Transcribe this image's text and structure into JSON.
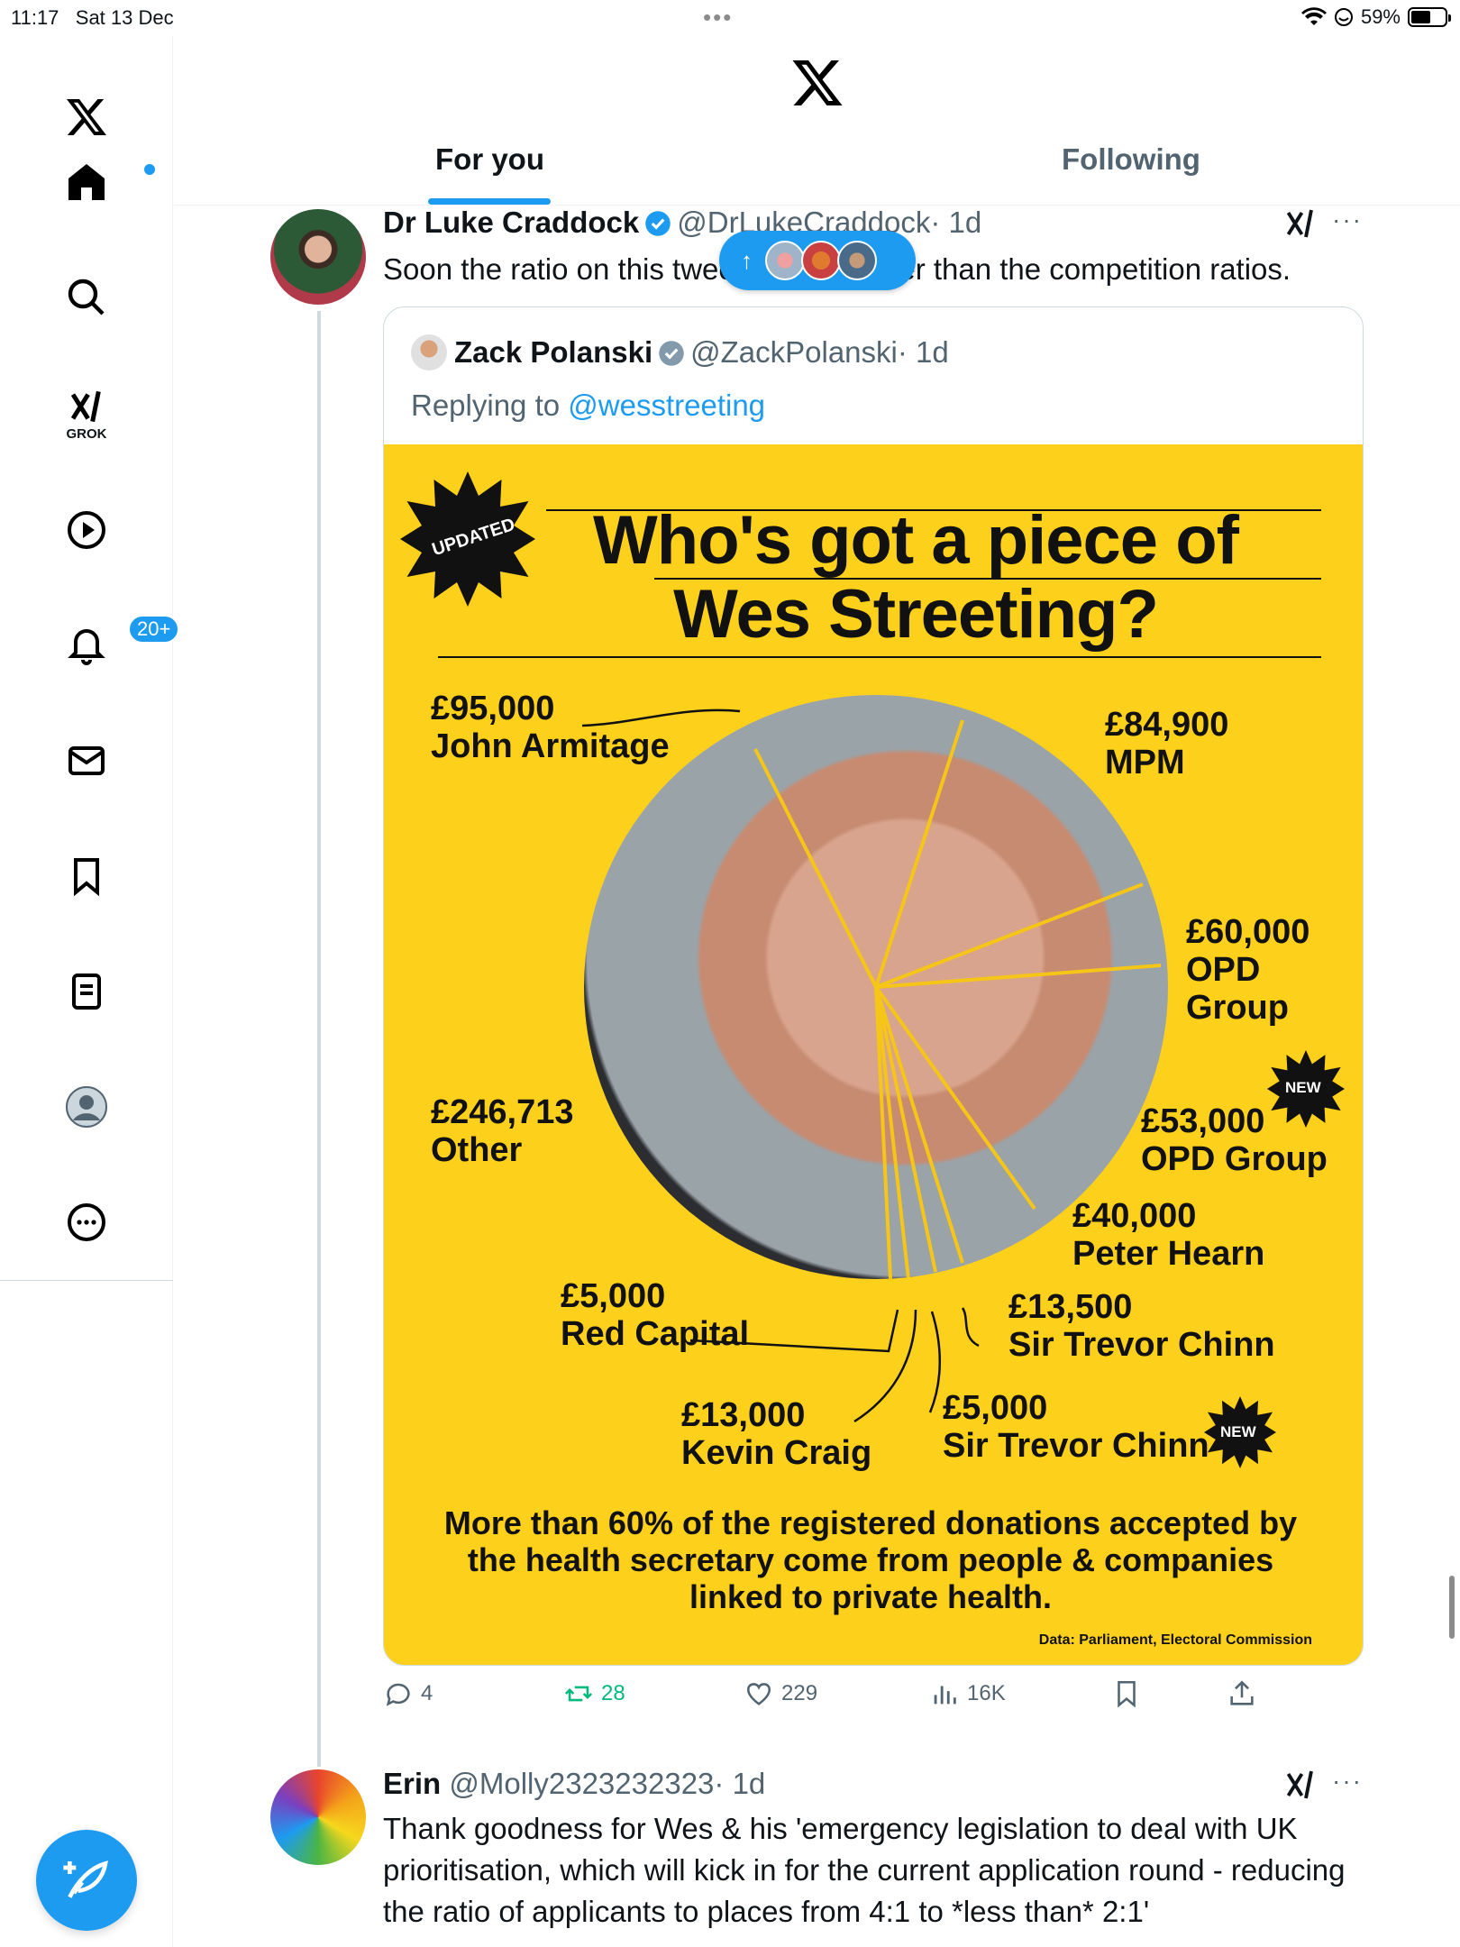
{
  "status": {
    "time": "11:17",
    "date": "Sat 13 Dec",
    "battery": "59%",
    "battery_level": 0.59
  },
  "sidebar": {
    "grok_label": "GROK",
    "notifications_badge": "20+"
  },
  "tabs": {
    "for_you": "For you",
    "following": "Following",
    "active": "for_you"
  },
  "post1": {
    "name": "Dr Luke Craddock",
    "handle": "@DrLukeCraddock",
    "time": "· 1d",
    "text": "Soon the ratio on this tweet will be higher than the competition ratios."
  },
  "quote": {
    "name": "Zack Polanski",
    "handle": "@ZackPolanski",
    "time": "· 1d",
    "replying_prefix": "Replying to",
    "replying_to": "@wesstreeting"
  },
  "infographic": {
    "badge_updated": "UPDATED",
    "title": "Who's got a piece of Wes Streeting?",
    "labels": {
      "armitage": "£95,000\nJohn Armitage",
      "mpm": "£84,900\nMPM",
      "opd1": "£60,000\nOPD\nGroup",
      "opd2": "£53,000\nOPD Group",
      "hearn": "£40,000\nPeter Hearn",
      "chinn1": "£13,500\nSir Trevor Chinn",
      "chinn2": "£5,000\nSir Trevor Chinn",
      "craig": "£13,000\nKevin Craig",
      "red": "£5,000\nRed Capital",
      "other": "£246,713\nOther"
    },
    "badge_new": "NEW",
    "footer": "More than 60% of the registered donations accepted by the health secretary come from people & companies linked to private health.",
    "source": "Data: Parliament, Electoral Commission"
  },
  "actions": {
    "replies": "4",
    "reposts": "28",
    "likes": "229",
    "views": "16K"
  },
  "post2": {
    "name": "Erin",
    "handle": "@Molly2323232323",
    "time": "· 1d",
    "text": "Thank goodness for Wes & his 'emergency legislation to deal with UK prioritisation, which will kick in for the current application round - reducing the ratio of applicants to places from 4:1 to *less than* 2:1'"
  },
  "colors": {
    "accent": "#1d9bf0",
    "repost": "#00ba7c",
    "infographic_bg": "#fdd01c"
  }
}
